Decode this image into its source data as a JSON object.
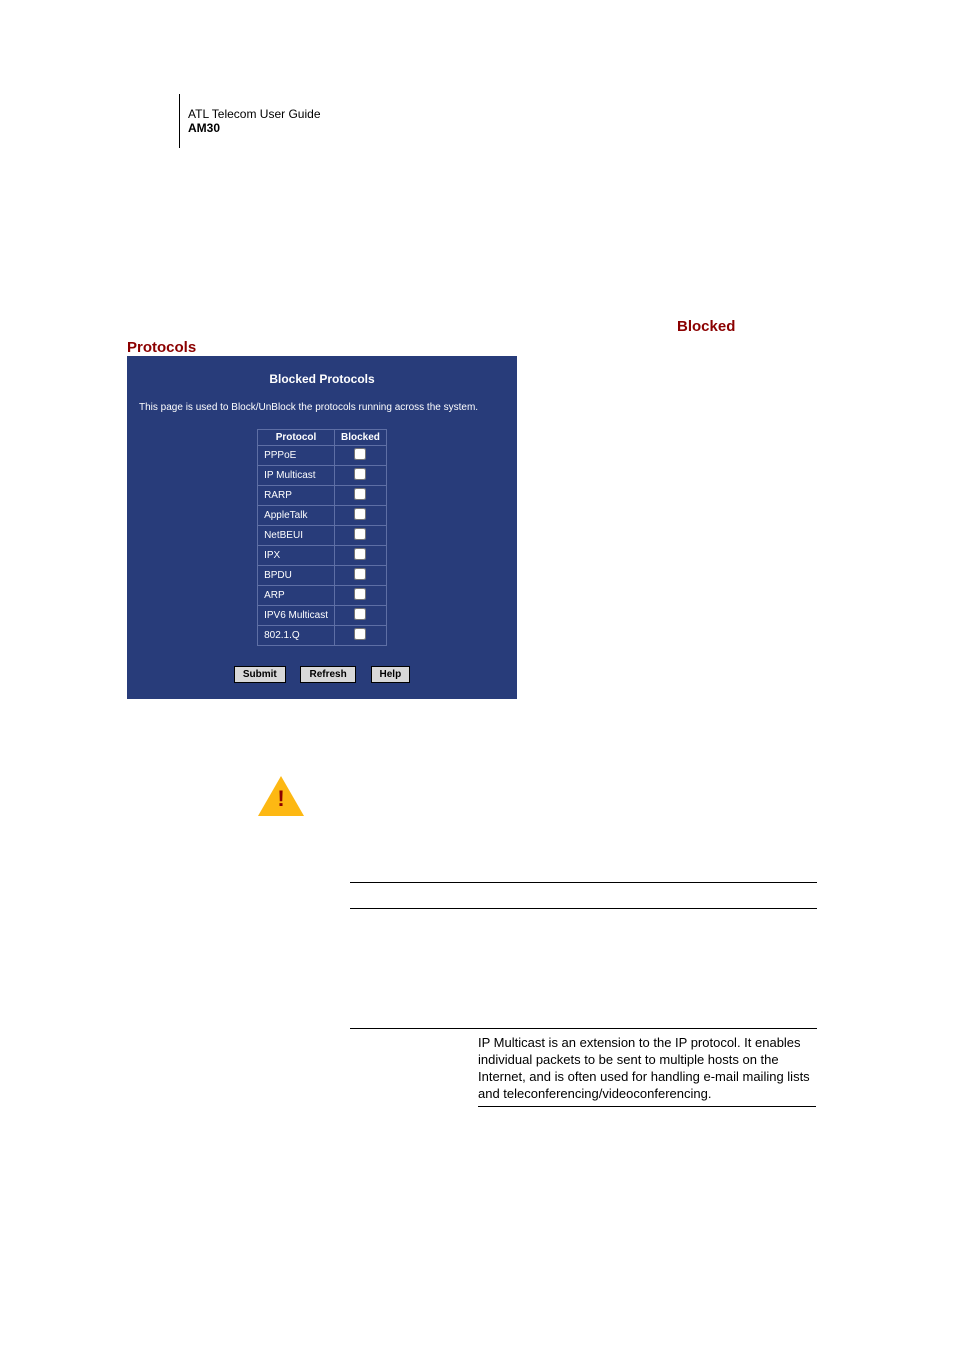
{
  "header": {
    "guide": "ATL Telecom User Guide",
    "model": "AM30"
  },
  "section": {
    "blocked": "Blocked",
    "protocols": "Protocols"
  },
  "panel": {
    "title": "Blocked Protocols",
    "description": "This page is used to Block/UnBlock the protocols running across the system.",
    "col_protocol": "Protocol",
    "col_blocked": "Blocked",
    "rows": [
      {
        "name": "PPPoE",
        "checked": false
      },
      {
        "name": "IP Multicast",
        "checked": false
      },
      {
        "name": "RARP",
        "checked": false
      },
      {
        "name": "AppleTalk",
        "checked": false
      },
      {
        "name": "NetBEUI",
        "checked": false
      },
      {
        "name": "IPX",
        "checked": false
      },
      {
        "name": "BPDU",
        "checked": false
      },
      {
        "name": "ARP",
        "checked": false
      },
      {
        "name": "IPV6 Multicast",
        "checked": false
      },
      {
        "name": "802.1.Q",
        "checked": false
      }
    ],
    "buttons": {
      "submit": "Submit",
      "refresh": "Refresh",
      "help": "Help"
    }
  },
  "description_block": "IP Multicast is an extension to the IP protocol. It enables individual packets to be sent to multiple hosts on the Internet, and is often used for handling e-mail mailing lists and teleconferencing/videoconferencing."
}
